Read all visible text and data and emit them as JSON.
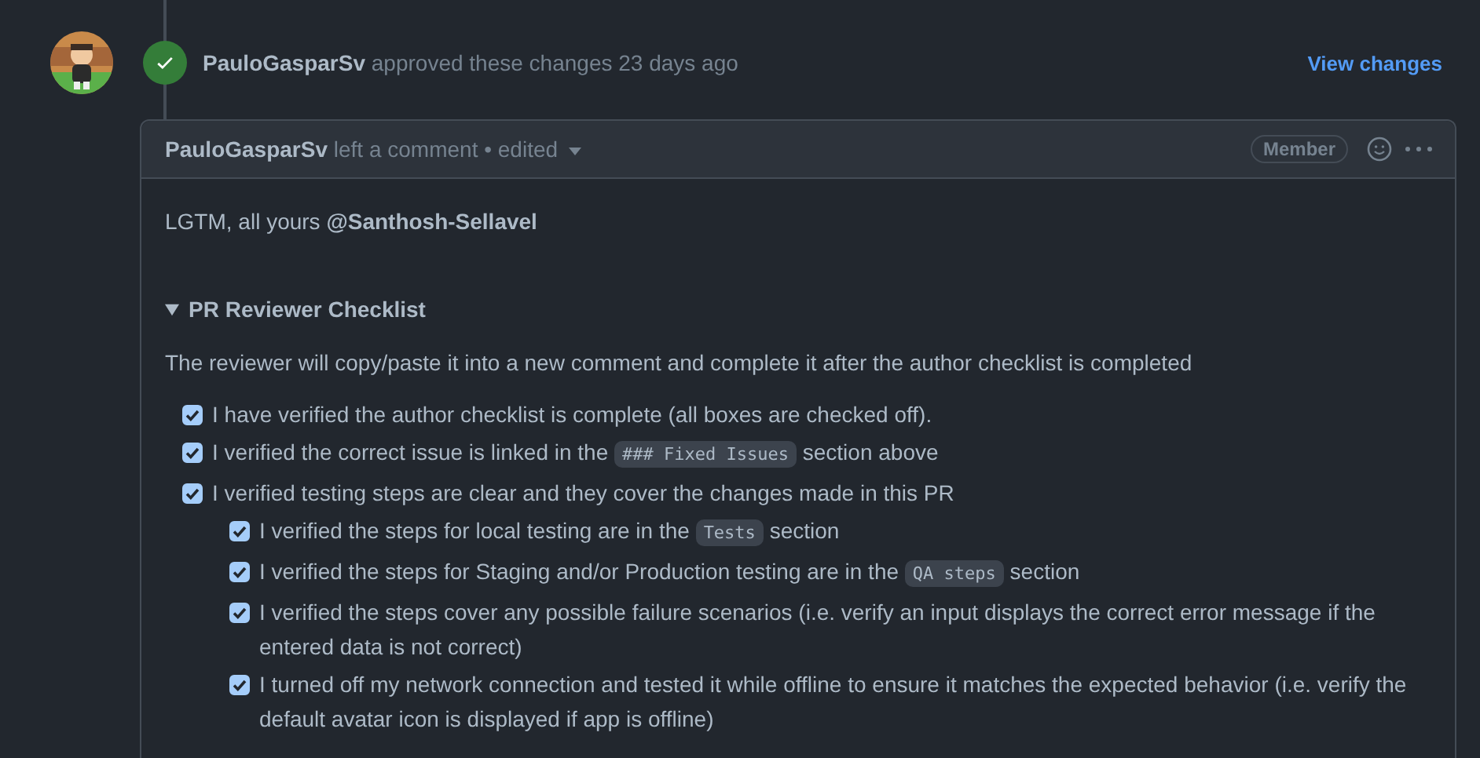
{
  "review": {
    "author": "PauloGasparSv",
    "action": "approved these changes",
    "time": "23 days ago",
    "approved": true,
    "link": "View changes"
  },
  "comment": {
    "author": "PauloGasparSv",
    "meta": "left a comment • edited",
    "role": "Member",
    "greeting": "LGTM, all yours **@Santhosh-Sellavel**",
    "details": {
      "summary": "PR Reviewer Checklist",
      "expanded": true
    },
    "intro": "The reviewer will copy/paste it into a new comment and complete it after the author checklist is completed",
    "checklist": [
      {
        "checked": true,
        "parts": [
          {
            "kind": "text",
            "text": "I have verified the author checklist is complete (all boxes are checked off)."
          }
        ]
      },
      {
        "checked": true,
        "parts": [
          {
            "kind": "text",
            "text": "I verified the correct issue is linked in the "
          },
          {
            "kind": "code",
            "text": "### Fixed Issues"
          },
          {
            "kind": "text",
            "text": " section above"
          }
        ]
      },
      {
        "checked": true,
        "parts": [
          {
            "kind": "text",
            "text": "I verified testing steps are clear and they cover the changes made in this PR"
          }
        ],
        "children": [
          {
            "checked": true,
            "parts": [
              {
                "kind": "text",
                "text": "I verified the steps for local testing are in the "
              },
              {
                "kind": "code",
                "text": "Tests"
              },
              {
                "kind": "text",
                "text": " section"
              }
            ]
          },
          {
            "checked": true,
            "parts": [
              {
                "kind": "text",
                "text": "I verified the steps for Staging and/or Production testing are in the "
              },
              {
                "kind": "code",
                "text": "QA steps"
              },
              {
                "kind": "text",
                "text": " section"
              }
            ]
          },
          {
            "checked": true,
            "parts": [
              {
                "kind": "text",
                "text": "I verified the steps cover any possible failure scenarios (i.e. verify an input displays the correct error message if the entered data is not correct)"
              }
            ]
          },
          {
            "checked": true,
            "parts": [
              {
                "kind": "text",
                "text": "I turned off my network connection and tested it while offline to ensure it matches the expected behavior (i.e. verify the default avatar icon is displayed if app is offline)"
              }
            ]
          }
        ]
      }
    ]
  }
}
